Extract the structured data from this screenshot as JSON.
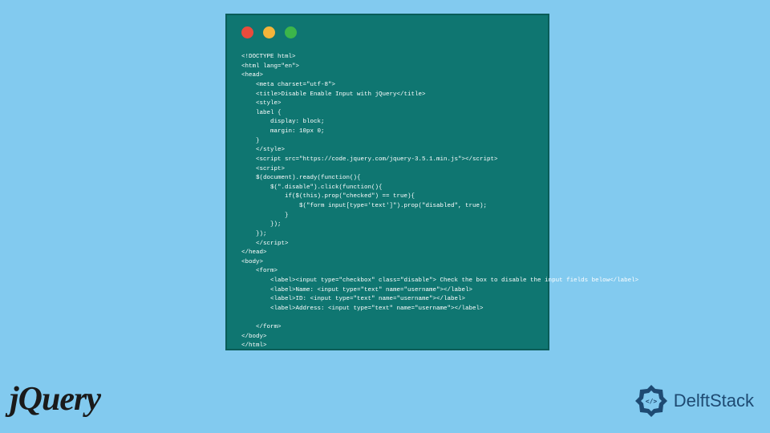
{
  "code_window": {
    "lines": [
      "<!DOCTYPE html>",
      "<html lang=\"en\">",
      "<head>",
      "    <meta charset=\"utf-8\">",
      "    <title>Disable Enable Input with jQuery</title>",
      "    <style>",
      "    label {",
      "        display: block;",
      "        margin: 10px 0;",
      "    }",
      "    </style>",
      "    <script src=\"https://code.jquery.com/jquery-3.5.1.min.js\"></script>",
      "    <script>",
      "    $(document).ready(function(){",
      "        $(\".disable\").click(function(){",
      "            if($(this).prop(\"checked\") == true){",
      "                $(\"form input[type='text']\").prop(\"disabled\", true);",
      "            }",
      "        });",
      "    });",
      "    </script>",
      "</head>",
      "<body>",
      "    <form>",
      "        <label><input type=\"checkbox\" class=\"disable\"> Check the box to disable the input fields below</label>",
      "        <label>Name: <input type=\"text\" name=\"username\"></label>",
      "        <label>ID: <input type=\"text\" name=\"username\"></label>",
      "        <label>Address: <input type=\"text\" name=\"username\"></label>",
      "",
      "    </form>",
      "</body>",
      "</html>"
    ]
  },
  "logos": {
    "jquery": "jQuery",
    "delftstack": "DelftStack"
  },
  "colors": {
    "background": "#82caef",
    "code_bg": "#0f7671",
    "dot_red": "#e94b3c",
    "dot_yellow": "#f3b43a",
    "dot_green": "#3cb54a"
  }
}
